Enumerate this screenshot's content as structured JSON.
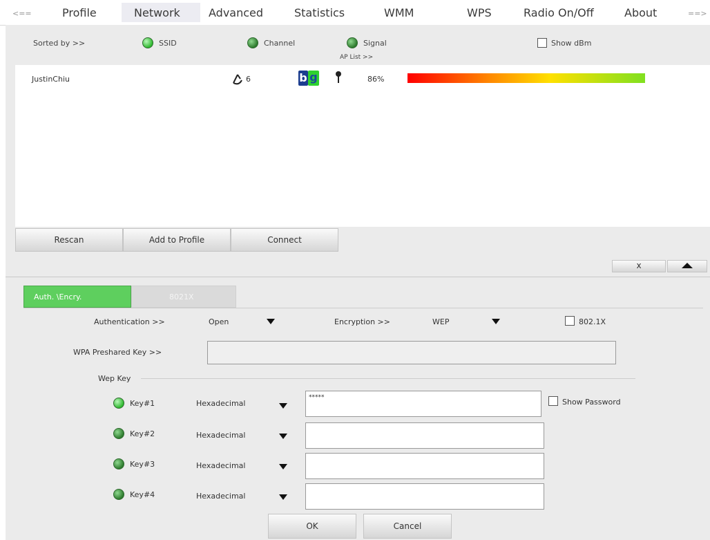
{
  "nav": {
    "prev": "<==",
    "items": [
      "Profile",
      "Network",
      "Advanced",
      "Statistics",
      "WMM",
      "WPS",
      "Radio On/Off",
      "About"
    ],
    "next": "==>"
  },
  "sort": {
    "label": "Sorted by >>",
    "ssid": "SSID",
    "channel": "Channel",
    "signal": "Signal",
    "show_dbm": "Show dBm",
    "ap_list": "AP List >>"
  },
  "ap_rows": [
    {
      "ssid": "JustinChiu",
      "channel": "6",
      "mode_b": "b",
      "mode_g": "g",
      "signal": "86%",
      "signal_value": 0.86
    }
  ],
  "buttons": {
    "rescan": "Rescan",
    "add_to_profile": "Add to Profile",
    "connect": "Connect",
    "collapse": "x",
    "ok": "OK",
    "cancel": "Cancel"
  },
  "tabs": {
    "auth": "Auth. \\Encry.",
    "p8021x": "8021X"
  },
  "auth": {
    "authentication_label": "Authentication >>",
    "authentication_value": "Open",
    "encryption_label": "Encryption >>",
    "encryption_value": "WEP",
    "p8021x_label": "802.1X",
    "wpa_label": "WPA Preshared Key >>",
    "wpa_value": ""
  },
  "wep": {
    "group_label": "Wep Key",
    "show_password": "Show Password",
    "keys": [
      {
        "label": "Key#1",
        "format": "Hexadecimal",
        "value": "*****"
      },
      {
        "label": "Key#2",
        "format": "Hexadecimal",
        "value": ""
      },
      {
        "label": "Key#3",
        "format": "Hexadecimal",
        "value": ""
      },
      {
        "label": "Key#4",
        "format": "Hexadecimal",
        "value": ""
      }
    ]
  },
  "colors": {
    "active_tab": "#5ecf5e",
    "nav_active": "#ececf2",
    "signal_start": "#ff0000",
    "signal_end": "#80e020"
  }
}
